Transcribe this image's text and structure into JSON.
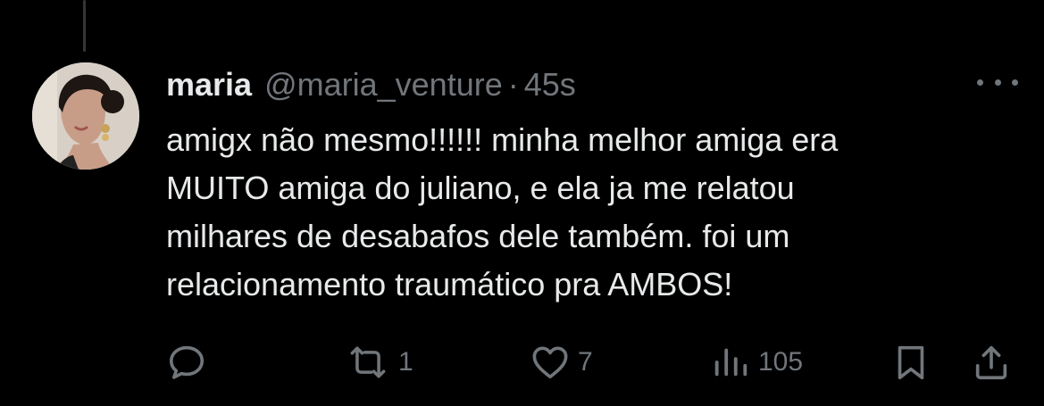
{
  "tweet": {
    "display_name": "maria",
    "handle": "@maria_venture",
    "separator": "·",
    "time": "45s",
    "text_lines": [
      "amigx não mesmo!!!!!! minha melhor amiga era",
      "MUITO amiga do juliano, e ela ja me relatou",
      "milhares de desabafos dele também. foi um",
      "relacionamento traumático pra AMBOS!"
    ]
  },
  "actions": {
    "reply": {
      "icon": "reply-icon",
      "count": ""
    },
    "retweet": {
      "icon": "retweet-icon",
      "count": "1"
    },
    "like": {
      "icon": "heart-icon",
      "count": "7"
    },
    "views": {
      "icon": "views-icon",
      "count": "105"
    },
    "bookmark": {
      "icon": "bookmark-icon",
      "count": ""
    },
    "share": {
      "icon": "share-icon",
      "count": ""
    }
  },
  "colors": {
    "background": "#000000",
    "text_primary": "#e7e9ea",
    "text_secondary": "#71767b",
    "thread_line": "#333639"
  }
}
